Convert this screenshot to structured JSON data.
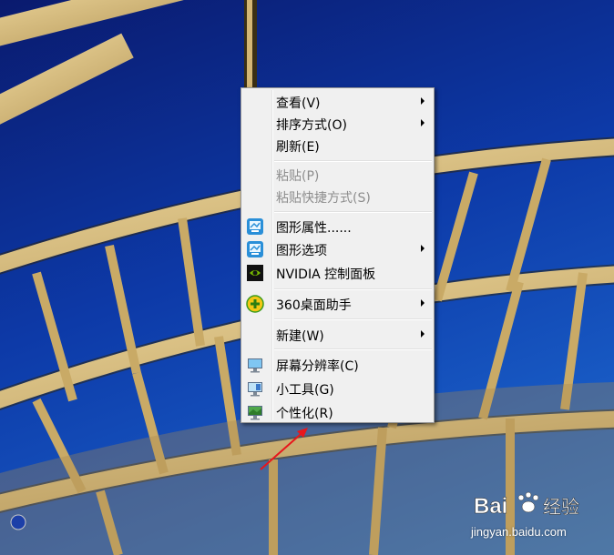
{
  "context_menu": {
    "items": [
      {
        "label": "查看(V)",
        "submenu": true,
        "disabled": false
      },
      {
        "label": "排序方式(O)",
        "submenu": true,
        "disabled": false
      },
      {
        "label": "刷新(E)",
        "submenu": false,
        "disabled": false
      },
      {
        "label": "粘贴(P)",
        "submenu": false,
        "disabled": true
      },
      {
        "label": "粘贴快捷方式(S)",
        "submenu": false,
        "disabled": true
      },
      {
        "label": "图形属性......",
        "submenu": false,
        "disabled": false,
        "icon": "intel-graphics-icon"
      },
      {
        "label": "图形选项",
        "submenu": true,
        "disabled": false,
        "icon": "intel-graphics-icon"
      },
      {
        "label": "NVIDIA 控制面板",
        "submenu": false,
        "disabled": false,
        "icon": "nvidia-icon"
      },
      {
        "label": "360桌面助手",
        "submenu": true,
        "disabled": false,
        "icon": "360-icon"
      },
      {
        "label": "新建(W)",
        "submenu": true,
        "disabled": false
      },
      {
        "label": "屏幕分辨率(C)",
        "submenu": false,
        "disabled": false,
        "icon": "display-icon"
      },
      {
        "label": "小工具(G)",
        "submenu": false,
        "disabled": false,
        "icon": "gadgets-icon"
      },
      {
        "label": "个性化(R)",
        "submenu": false,
        "disabled": false,
        "icon": "personalize-icon"
      }
    ]
  },
  "watermark": {
    "brand": "Bai 经验",
    "url": "jingyan.baidu.com"
  },
  "colors": {
    "menu_bg": "#f0f0f0",
    "sky_dark": "#0a1a6e",
    "sky_light": "#1f6fd6",
    "beam": "#e2c784",
    "arrow": "#e8161c"
  }
}
